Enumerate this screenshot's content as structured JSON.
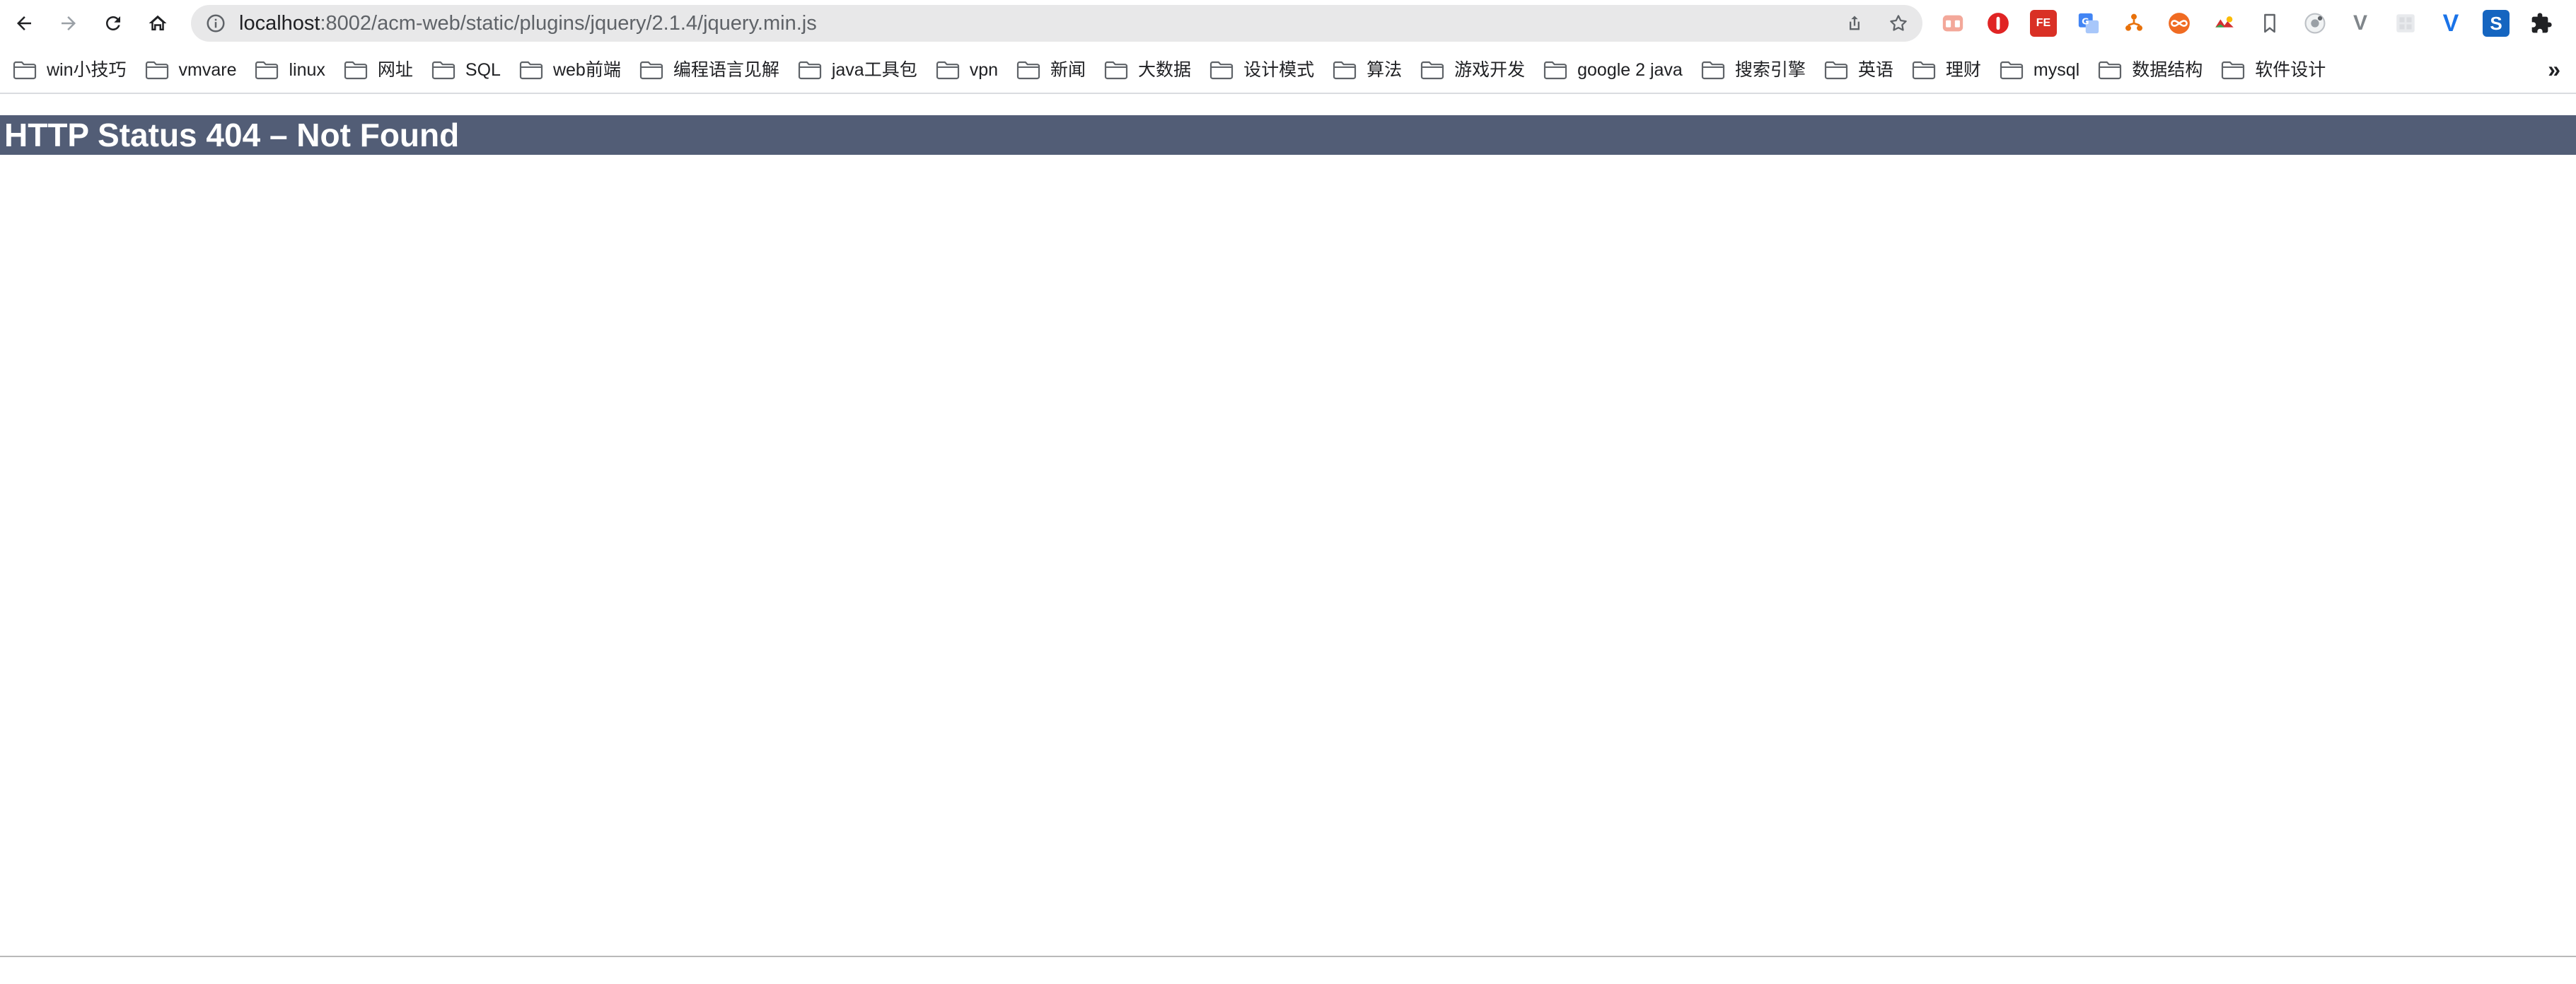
{
  "browser": {
    "url_host": "localhost",
    "url_path": ":8002/acm-web/static/plugins/jquery/2.1.4/jquery.min.js",
    "nav_icons": [
      "back-arrow-icon",
      "forward-arrow-icon",
      "reload-icon",
      "home-icon"
    ],
    "omnibox_icons": [
      "info-icon",
      "share-icon",
      "bookmark-star-icon"
    ],
    "extension_icons": [
      "extension-cookie-icon",
      "extension-stop-icon",
      "extension-fe-icon",
      "extension-translate-icon",
      "extension-tree-icon",
      "extension-infinity-icon",
      "extension-color-icon",
      "extension-bookmark-icon",
      "extension-capture-icon",
      "extension-vue-icon",
      "extension-grid-icon",
      "extension-v-icon",
      "extension-s-icon",
      "extensions-puzzle-icon"
    ],
    "extension_labels": {
      "fe": "FE",
      "vue": "V",
      "s": "S"
    },
    "colors": {
      "omnibox": "#e8e8e9",
      "heading_bar": "#525d76"
    }
  },
  "bookmarks": {
    "items": [
      {
        "label": "win小技巧"
      },
      {
        "label": "vmvare"
      },
      {
        "label": "linux"
      },
      {
        "label": "网址"
      },
      {
        "label": "SQL"
      },
      {
        "label": "web前端"
      },
      {
        "label": "编程语言见解"
      },
      {
        "label": "java工具包"
      },
      {
        "label": "vpn"
      },
      {
        "label": "新闻"
      },
      {
        "label": "大数据"
      },
      {
        "label": "设计模式"
      },
      {
        "label": "算法"
      },
      {
        "label": "游戏开发"
      },
      {
        "label": "google 2 java"
      },
      {
        "label": "搜索引擎"
      },
      {
        "label": "英语"
      },
      {
        "label": "理财"
      },
      {
        "label": "mysql"
      },
      {
        "label": "数据结构"
      },
      {
        "label": "软件设计"
      }
    ],
    "more": "»"
  },
  "page": {
    "heading": "HTTP Status 404 – Not Found"
  }
}
